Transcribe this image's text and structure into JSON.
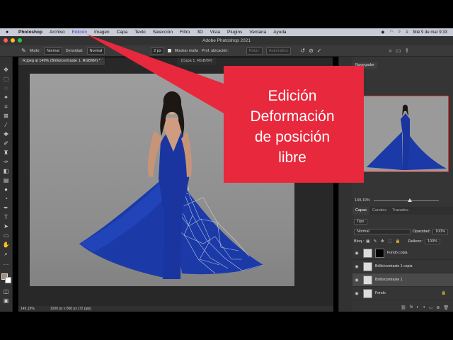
{
  "menubar": {
    "items": [
      "Photoshop",
      "Archivo",
      "Edición",
      "Imagen",
      "Capa",
      "Texto",
      "Selección",
      "Filtro",
      "3D",
      "Vista",
      "Plugins",
      "Ventana",
      "Ayuda"
    ],
    "datetime": "Mié 9 de mar  9:33"
  },
  "titlebar": {
    "title": "Adobe Photoshop 2021"
  },
  "options": {
    "mode_label": "Modo:",
    "mode_value": "Normal",
    "density_label": "Densidad:",
    "density_value": "Normal",
    "expand_value": "2 px",
    "show_mesh": "Mostrar malla",
    "pin_depth_label": "Prof. ubicación:",
    "rotate_label": "Rotar:",
    "rotate_value": "Automático"
  },
  "tabs": [
    {
      "label": "R.jpeg al 149% (Brillo/contraste 1, RGB/8#) *",
      "active": true
    },
    {
      "label": "Blu",
      "active": false
    },
    {
      "label": "(Capa 1, RGB/8#)",
      "active": false
    }
  ],
  "status": {
    "zoom": "149,19%",
    "size": "1000 px x 800 px (72 ppp)"
  },
  "navigator": {
    "tab": "Navegador",
    "zoom": "149,19%"
  },
  "layers_panel": {
    "tabs": [
      "Capas",
      "Canales",
      "Trazados"
    ],
    "filter": "Tipo",
    "blend": "Normal",
    "opacity_label": "Opacidad:",
    "opacity_value": "100%",
    "lock_label": "Bloq.:",
    "fill_label": "Relleno:",
    "fill_value": "100%",
    "layers": [
      {
        "name": "Fondo copia"
      },
      {
        "name": "Brillo/contraste 1 copia"
      },
      {
        "name": "Brillo/contraste 1"
      },
      {
        "name": "Fondo"
      }
    ]
  },
  "callout": {
    "lines": [
      "Edición",
      "Deformación",
      "de posición",
      "libre"
    ],
    "color": "#e8283c"
  },
  "colors": {
    "accent": "#e8283c",
    "dress": "#1b3aa8",
    "background_swatch": "#a88d7a"
  }
}
